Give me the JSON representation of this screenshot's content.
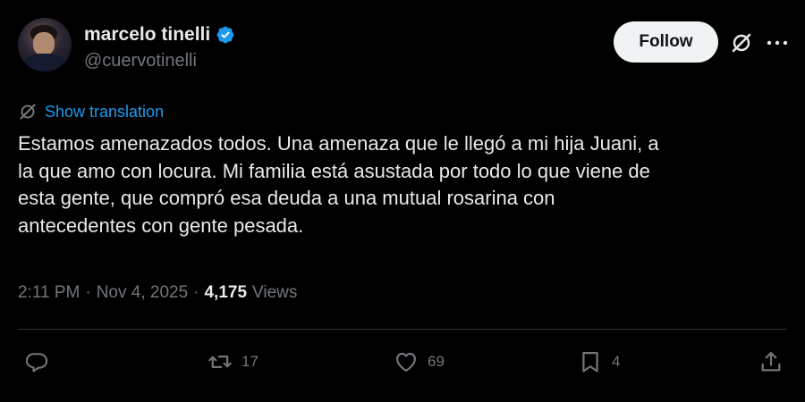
{
  "author": {
    "display_name": "marcelo tinelli",
    "handle": "@cuervotinelli",
    "verified": true,
    "verified_color": "#1d9bf0"
  },
  "header": {
    "follow_label": "Follow"
  },
  "translation": {
    "label": "Show translation"
  },
  "tweet": {
    "text": "Estamos amenazados todos. Una amenaza que le llegó a mi hija Juani, a\nla que amo con locura. Mi familia está asustada por todo lo que viene de\nesta gente, que compró esa deuda a una mutual rosarina con\nantecedentes con gente pesada."
  },
  "meta": {
    "time": "2:11 PM",
    "separator": "·",
    "date": "Nov 4, 2025",
    "views_count": "4,175",
    "views_label": "Views"
  },
  "actions": {
    "reply_count": "",
    "repost_count": "17",
    "like_count": "69",
    "bookmark_count": "4"
  },
  "colors": {
    "background": "#000000",
    "text": "#e7e9ea",
    "muted": "#71767b",
    "accent": "#1d9bf0",
    "follow_bg": "#eff3f4"
  }
}
